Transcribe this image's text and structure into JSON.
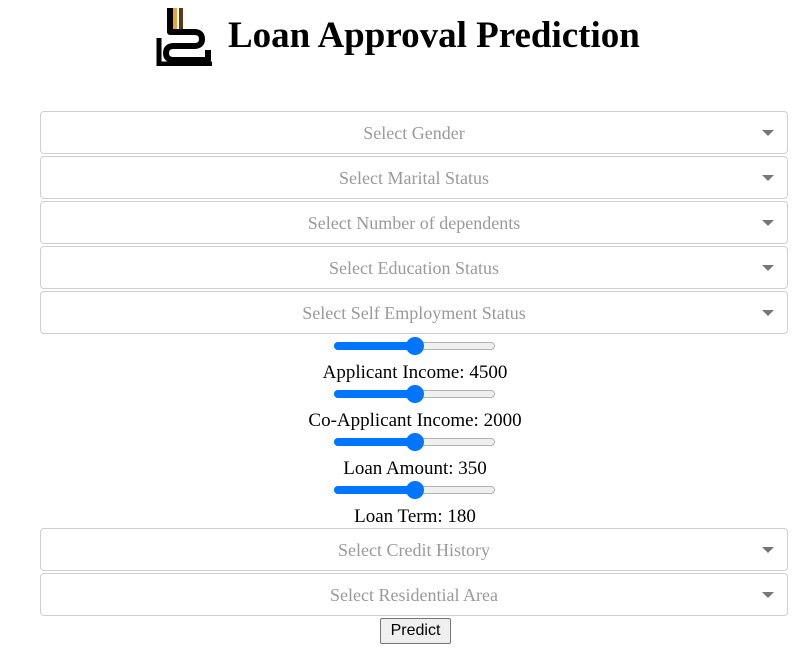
{
  "page": {
    "title": "Loan Approval Prediction",
    "logo_icon": "loan-logo-icon"
  },
  "form": {
    "selects": {
      "gender": {
        "placeholder": "Select Gender"
      },
      "marital_status": {
        "placeholder": "Select Marital Status"
      },
      "dependents": {
        "placeholder": "Select Number of dependents"
      },
      "education": {
        "placeholder": "Select Education Status"
      },
      "self_employment": {
        "placeholder": "Select Self Employment Status"
      },
      "credit_history": {
        "placeholder": "Select Credit History"
      },
      "residential_area": {
        "placeholder": "Select Residential Area"
      }
    },
    "sliders": {
      "applicant_income": {
        "label": "Applicant Income: 4500",
        "position_fraction": 0.5
      },
      "coapplicant_income": {
        "label": "Co-Applicant Income: 2000",
        "position_fraction": 0.5
      },
      "loan_amount": {
        "label": "Loan Amount: 350",
        "position_fraction": 0.5
      },
      "loan_term": {
        "label": "Loan Term: 180",
        "position_fraction": 0.5
      }
    },
    "predict_label": "Predict"
  },
  "colors": {
    "accent": "#0075ff",
    "placeholder_text": "#9a9a9a",
    "border": "#cfcfcf"
  }
}
